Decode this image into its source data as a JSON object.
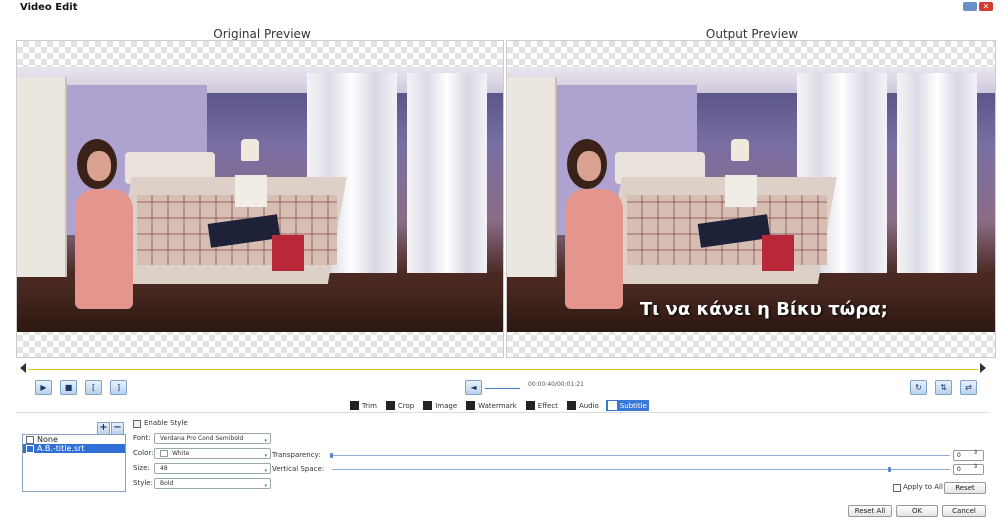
{
  "window": {
    "title": "Video Edit",
    "close_glyph": "✕"
  },
  "previews": {
    "original_label": "Original Preview",
    "output_label": "Output Preview",
    "subtitle_text": "Τι να κάνει η Βίκυ τώρα;"
  },
  "timecode": "00:00:40/00:01:21",
  "tabs": [
    {
      "label": "Trim",
      "icon": "scissors-icon"
    },
    {
      "label": "Crop",
      "icon": "crop-icon"
    },
    {
      "label": "Image",
      "icon": "image-icon"
    },
    {
      "label": "Watermark",
      "icon": "watermark-icon"
    },
    {
      "label": "Effect",
      "icon": "star-icon"
    },
    {
      "label": "Audio",
      "icon": "music-note-icon"
    },
    {
      "label": "Subtitle",
      "icon": "subtitle-icon",
      "active": true
    }
  ],
  "subtitle_list": {
    "items": [
      {
        "label": "None",
        "checked": false
      },
      {
        "label": "A.B.-title.srt",
        "checked": true,
        "selected": true
      }
    ]
  },
  "style": {
    "enable_label": "Enable Style",
    "font_label": "Font:",
    "font_value": "Verdana Pro Cond Semibold",
    "color_label": "Color:",
    "color_value": "White",
    "size_label": "Size:",
    "size_value": "48",
    "style_label": "Style:",
    "style_value": "Bold"
  },
  "adjust": {
    "transparency_label": "Transparency:",
    "transparency_value": "0",
    "vertical_label": "Vertical Space:",
    "vertical_value": "0"
  },
  "buttons": {
    "apply_all": "Apply to All",
    "reset": "Reset",
    "reset_all": "Reset All",
    "ok": "OK",
    "cancel": "Cancel",
    "add": "+",
    "remove": "−"
  },
  "colors": {
    "accent": "#3a78d8",
    "timeline": "#e8c020"
  }
}
